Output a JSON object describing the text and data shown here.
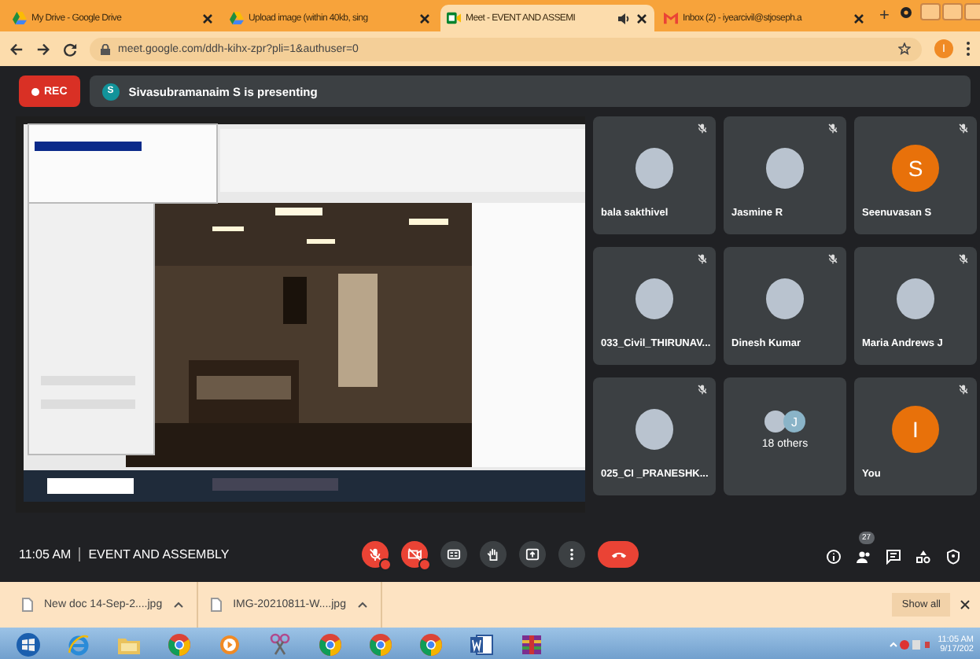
{
  "tabs": [
    {
      "title": "My Drive - Google Drive",
      "kind": "drive",
      "selected": false,
      "audio": false
    },
    {
      "title": "Upload image (within 40kb, sing",
      "kind": "drive",
      "selected": false,
      "audio": false
    },
    {
      "title": "Meet - EVENT AND ASSEMI",
      "kind": "meet",
      "selected": true,
      "audio": true
    },
    {
      "title": "Inbox (2) - iyearcivil@stjoseph.a",
      "kind": "mail",
      "selected": false,
      "audio": false
    }
  ],
  "new_tab": "+",
  "address": "meet.google.com/ddh-kihx-zpr?pli=1&authuser=0",
  "profile_initial": "I",
  "rec": "REC",
  "presenter": {
    "initial": "S",
    "text": "Sivasubramanaim S is presenting"
  },
  "participants": [
    {
      "kind": "photo",
      "name": "bala sakthivel",
      "muted": true
    },
    {
      "kind": "photo",
      "name": "Jasmine R",
      "muted": true
    },
    {
      "kind": "initial",
      "initial": "S",
      "name": "Seenuvasan S",
      "muted": true
    },
    {
      "kind": "photo",
      "name": "033_Civil_THIRUNAV...",
      "muted": true
    },
    {
      "kind": "photo",
      "name": "Dinesh Kumar",
      "muted": true
    },
    {
      "kind": "photo",
      "name": "Maria Andrews J",
      "muted": true
    },
    {
      "kind": "photo",
      "name": "025_CI _PRANESHK...",
      "muted": true
    },
    {
      "kind": "others",
      "initial": "J",
      "name": "18 others",
      "muted": false
    },
    {
      "kind": "initial",
      "initial": "I",
      "name": "You",
      "muted": true
    }
  ],
  "meeting": {
    "time": "11:05 AM",
    "title": "EVENT AND ASSEMBLY"
  },
  "controls": [
    {
      "kind": "mic-off",
      "alert": true
    },
    {
      "kind": "camera-off",
      "alert": true
    },
    {
      "kind": "captions",
      "alert": false
    },
    {
      "kind": "hand",
      "alert": false
    },
    {
      "kind": "present",
      "alert": false
    },
    {
      "kind": "more",
      "alert": false
    },
    {
      "kind": "end-call",
      "alert": false
    }
  ],
  "side_controls": [
    {
      "kind": "info"
    },
    {
      "kind": "people",
      "badge": "27"
    },
    {
      "kind": "chat"
    },
    {
      "kind": "activities"
    },
    {
      "kind": "host"
    }
  ],
  "downloads": [
    "New doc 14-Sep-2....jpg",
    "IMG-20210811-W....jpg"
  ],
  "show_all": "Show all",
  "taskbar": {
    "apps": [
      {
        "kind": "start"
      },
      {
        "kind": "ie"
      },
      {
        "kind": "folder"
      },
      {
        "kind": "chrome"
      },
      {
        "kind": "media"
      },
      {
        "kind": "paint"
      },
      {
        "kind": "chrome"
      },
      {
        "kind": "chrome"
      },
      {
        "kind": "chrome"
      },
      {
        "kind": "word"
      },
      {
        "kind": "archive"
      }
    ],
    "time": "11:05 AM",
    "date": "9/17/202"
  }
}
